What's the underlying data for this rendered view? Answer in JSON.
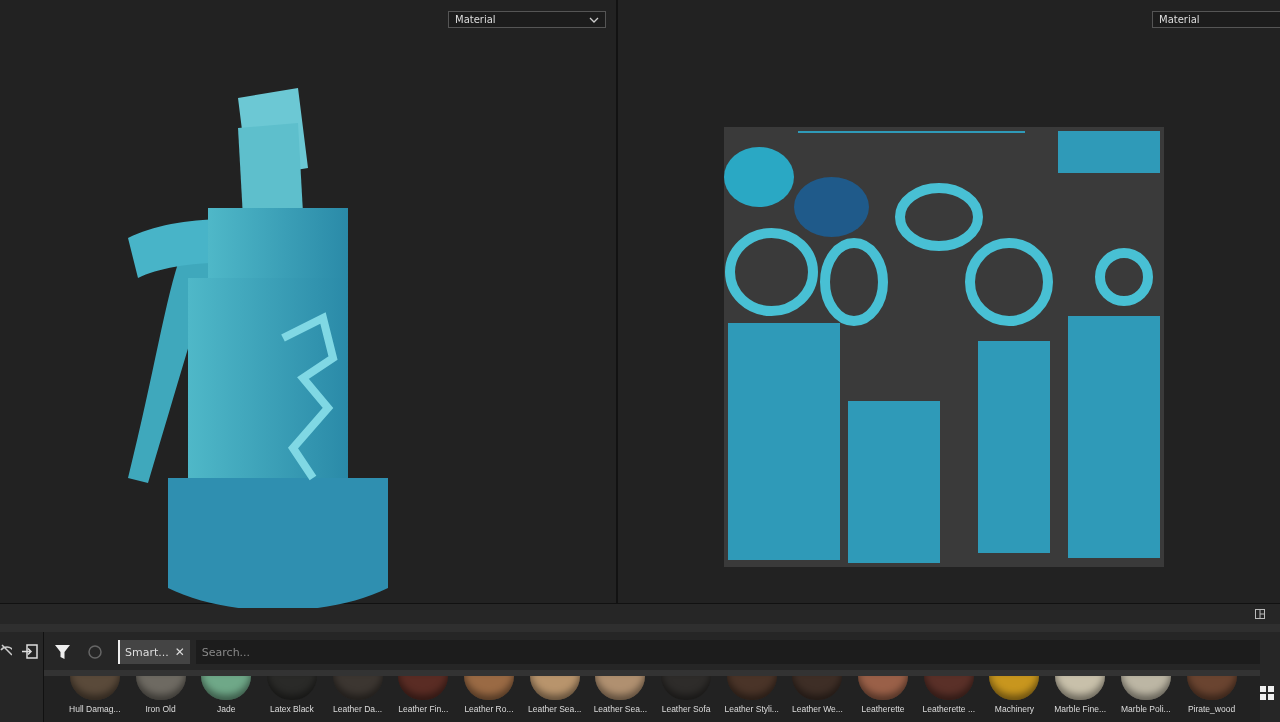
{
  "viewports": [
    {
      "kind": "model",
      "dropdown": {
        "value": "Material"
      }
    },
    {
      "kind": "uv",
      "dropdown": {
        "value": "Material"
      }
    }
  ],
  "shelf": {
    "tag": {
      "label": "Smart...",
      "close": "✕"
    },
    "search": {
      "placeholder": "Search..."
    },
    "materials": [
      {
        "name": "Hull Damag...",
        "color": "#5a4a3a"
      },
      {
        "name": "Iron Old",
        "color": "#6e6a62"
      },
      {
        "name": "Jade",
        "color": "#6fa888"
      },
      {
        "name": "Latex Black",
        "color": "#2a2a28"
      },
      {
        "name": "Leather Da...",
        "color": "#3c3631"
      },
      {
        "name": "Leather Fin...",
        "color": "#5a2c24"
      },
      {
        "name": "Leather Ro...",
        "color": "#9a6a44"
      },
      {
        "name": "Leather Sea...",
        "color": "#b8946c"
      },
      {
        "name": "Leather Sea...",
        "color": "#b09070"
      },
      {
        "name": "Leather Sofa",
        "color": "#2e2c2a"
      },
      {
        "name": "Leather Styli...",
        "color": "#4a3428"
      },
      {
        "name": "Leather We...",
        "color": "#3e2e26"
      },
      {
        "name": "Leatherette",
        "color": "#9a6048"
      },
      {
        "name": "Leatherette ...",
        "color": "#5a3028"
      },
      {
        "name": "Machinery",
        "color": "#c8961e"
      },
      {
        "name": "Marble Fine...",
        "color": "#c8c0aa"
      },
      {
        "name": "Marble Poli...",
        "color": "#bcb6a4"
      },
      {
        "name": "Pirate_wood",
        "color": "#6a4430"
      }
    ]
  }
}
